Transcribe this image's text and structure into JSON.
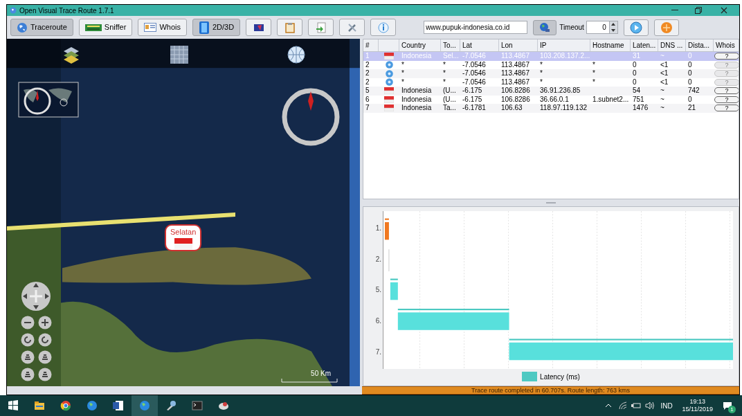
{
  "window": {
    "title": "Open Visual Trace Route 1.7.1"
  },
  "toolbar": {
    "buttons": [
      {
        "label": "Traceroute",
        "selected": true,
        "kind": "globe"
      },
      {
        "label": "Sniffer",
        "selected": false,
        "kind": "card"
      },
      {
        "label": "Whois",
        "selected": false,
        "kind": "id"
      },
      {
        "label": "2D/3D",
        "selected": true,
        "kind": "cube"
      }
    ],
    "address": "www.pupuk-indonesia.co.id",
    "timeout_label": "Timeout",
    "timeout_value": "0"
  },
  "map": {
    "placemark": "Selatan",
    "scale": "50 Km"
  },
  "table": {
    "columns": [
      "#",
      "Country",
      "To...",
      "Lat",
      "Lon",
      "IP",
      "Hostname",
      "Laten...",
      "DNS ...",
      "Dista...",
      "Whois"
    ],
    "rows": [
      {
        "kind": "flag",
        "selected": true,
        "whois_disabled": false,
        "cells": [
          "1",
          "Indonesia",
          "Sel...",
          "-7.0546",
          "113.4867",
          "103.208.137.2...",
          null,
          "31",
          "~",
          "0",
          "?"
        ]
      },
      {
        "kind": "unknown",
        "selected": false,
        "whois_disabled": true,
        "cells": [
          "2",
          "*",
          "*",
          "-7.0546",
          "113.4867",
          "*",
          "*",
          "0",
          "<1",
          "0",
          "?"
        ]
      },
      {
        "kind": "unknown",
        "selected": false,
        "whois_disabled": true,
        "cells": [
          "2",
          "*",
          "*",
          "-7.0546",
          "113.4867",
          "*",
          "*",
          "0",
          "<1",
          "0",
          "?"
        ]
      },
      {
        "kind": "unknown",
        "selected": false,
        "whois_disabled": true,
        "cells": [
          "2",
          "*",
          "*",
          "-7.0546",
          "113.4867",
          "*",
          "*",
          "0",
          "<1",
          "0",
          "?"
        ]
      },
      {
        "kind": "flag",
        "selected": false,
        "whois_disabled": false,
        "cells": [
          "5",
          "Indonesia",
          "(U...",
          "-6.175",
          "106.8286",
          "36.91.236.85",
          null,
          "54",
          "~",
          "742",
          "?"
        ]
      },
      {
        "kind": "flag",
        "selected": false,
        "whois_disabled": false,
        "cells": [
          "6",
          "Indonesia",
          "(U...",
          "-6.175",
          "106.8286",
          "36.66.0.1",
          "1.subnet2...",
          "751",
          "~",
          "0",
          "?"
        ]
      },
      {
        "kind": "flag",
        "selected": false,
        "whois_disabled": false,
        "cells": [
          "7",
          "Indonesia",
          "Ta...",
          "-6.1781",
          "106.63",
          "118.97.119.132",
          null,
          "1476",
          "~",
          "21",
          "?"
        ]
      }
    ]
  },
  "chart": {
    "row_labels": [
      "1.",
      "2.",
      "5.",
      "6.",
      "7."
    ],
    "legend": "Latency (ms)"
  },
  "status": "Trace route completed in 60.707s. Route length: 763 kms",
  "taskbar": {
    "language": "IND",
    "time": "19:13",
    "date": "15/11/2019",
    "notifications": "1"
  }
}
